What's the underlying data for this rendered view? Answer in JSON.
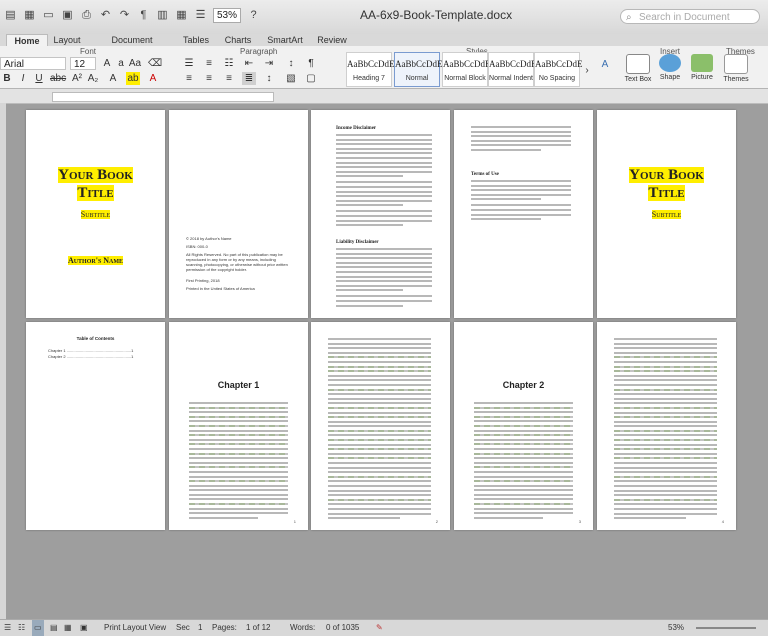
{
  "window": {
    "title": "AA-6x9-Book-Template.docx"
  },
  "toolbar": {
    "zoom": "53%",
    "search_placeholder": "Search in Document"
  },
  "tabs": [
    "Home",
    "Layout",
    "Document Elements",
    "Tables",
    "Charts",
    "SmartArt",
    "Review"
  ],
  "ribbon": {
    "group_font": "Font",
    "group_paragraph": "Paragraph",
    "group_styles": "Styles",
    "group_insert": "Insert",
    "group_themes": "Themes",
    "font_name": "Arial",
    "font_size": "12",
    "styles": [
      {
        "preview": "AaBbCcDdE",
        "name": "Heading 7"
      },
      {
        "preview": "AaBbCcDdE",
        "name": "Normal"
      },
      {
        "preview": "AaBbCcDdE",
        "name": "Normal Block"
      },
      {
        "preview": "AaBbCcDdE",
        "name": "Normal Indent"
      },
      {
        "preview": "AaBbCcDdE",
        "name": "No Spacing"
      }
    ],
    "insert": [
      "Text Box",
      "Shape",
      "Picture"
    ],
    "themes_label": "Themes"
  },
  "pages": {
    "title": {
      "line1": "Your Book",
      "line2": "Title",
      "subtitle": "Subtitle",
      "author": "Author's Name"
    },
    "copyright": {
      "line1": "© 2018 by Author's Name",
      "isbn": "ISBN: 000-0",
      "rights": "All Rights Reserved. No part of this publication may be reproduced in any form or by any means, including scanning, photocopying, or otherwise without prior written permission of the copyright holder.",
      "printing": "First Printing, 2018",
      "printed": "Printed in the United States of America"
    },
    "disclaimer": {
      "h1": "Income Disclaimer",
      "h2": "Liability Disclaimer"
    },
    "terms": {
      "h1": "Terms of Use"
    },
    "toc": {
      "title": "Table of Contents",
      "c1": "Chapter 1 ..........................................................1",
      "c2": "Chapter 2 ..........................................................1"
    },
    "chapter1": {
      "title": "Chapter 1"
    },
    "chapter2": {
      "title": "Chapter 2"
    }
  },
  "status": {
    "view": "Print Layout View",
    "sec_label": "Sec",
    "sec": "1",
    "pages_label": "Pages:",
    "pages": "1 of 12",
    "words_label": "Words:",
    "words": "0 of 1035",
    "zoom": "53%"
  }
}
